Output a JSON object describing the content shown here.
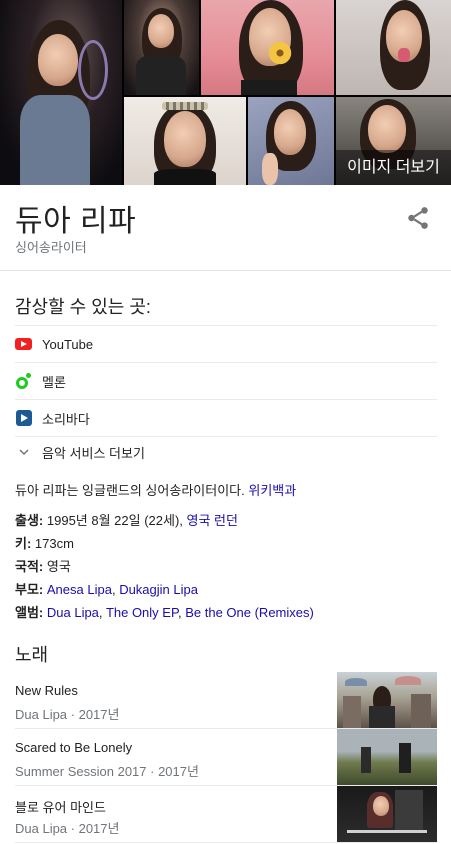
{
  "image_grid": {
    "more_label": "이미지 더보기"
  },
  "header": {
    "title": "듀아 리파",
    "subtitle": "싱어송라이터",
    "share_icon": "share-icon"
  },
  "listen": {
    "heading": "감상할 수 있는 곳:",
    "services": [
      {
        "label": "YouTube",
        "icon": "youtube-icon",
        "color": "#e62117"
      },
      {
        "label": "멜론",
        "icon": "melon-icon",
        "color": "#1ecc1e"
      },
      {
        "label": "소리바다",
        "icon": "soribada-icon",
        "color": "#1c5a93"
      }
    ],
    "more_label": "음악 서비스 더보기"
  },
  "description": {
    "text": "듀아 리파는 잉글랜드의 싱어송라이터이다.",
    "source": "위키백과"
  },
  "facts": {
    "born_label": "출생:",
    "born_value": "1995년 8월 22일 (22세),",
    "born_link": "영국 런던",
    "height_label": "키:",
    "height_value": "173cm",
    "nationality_label": "국적:",
    "nationality_value": "영국",
    "parents_label": "부모:",
    "parent_1": "Anesa Lipa",
    "parent_sep": ",",
    "parent_2": "Dukagjin Lipa",
    "albums_label": "앨범:",
    "album_1": "Dua Lipa",
    "album_2": "The Only EP",
    "album_3": "Be the One (Remixes)",
    "album_sep": ","
  },
  "songs": {
    "heading": "노래",
    "items": [
      {
        "title": "New Rules",
        "meta": "Dua Lipa · 2017년"
      },
      {
        "title": "Scared to Be Lonely",
        "meta": "Summer Session 2017 · 2017년"
      },
      {
        "title": "블로 유어 마인드",
        "meta": "Dua Lipa · 2017년"
      }
    ]
  },
  "colors": {
    "link": "#1a0dab",
    "secondary_text": "#70757a"
  }
}
